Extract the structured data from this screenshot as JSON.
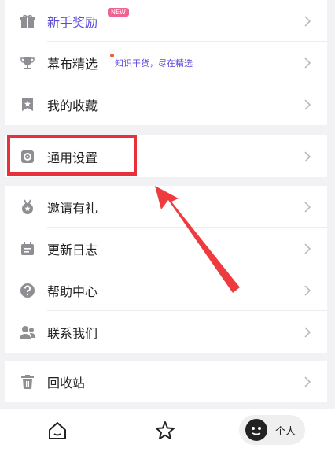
{
  "menu": {
    "group1": [
      {
        "label": "新手奖励",
        "icon": "gift-icon",
        "badge": "NEW",
        "accent": true
      },
      {
        "label": "幕布精选",
        "icon": "trophy-icon",
        "subtitle": "知识干货，尽在精选"
      },
      {
        "label": "我的收藏",
        "icon": "bookmark-star-icon"
      }
    ],
    "group2": [
      {
        "label": "通用设置",
        "icon": "settings-gear-icon"
      }
    ],
    "group3": [
      {
        "label": "邀请有礼",
        "icon": "medal-icon"
      },
      {
        "label": "更新日志",
        "icon": "calendar-log-icon"
      },
      {
        "label": "帮助中心",
        "icon": "question-circle-icon"
      },
      {
        "label": "联系我们",
        "icon": "contacts-icon"
      }
    ],
    "group4": [
      {
        "label": "回收站",
        "icon": "trash-icon"
      }
    ]
  },
  "tabbar": {
    "home_icon": "home-icon",
    "favorites_icon": "star-icon",
    "profile_label": "个人"
  },
  "colors": {
    "accent": "#5b4bd6",
    "annotation_red": "#e8303a",
    "badge_pink": "#f06292"
  }
}
